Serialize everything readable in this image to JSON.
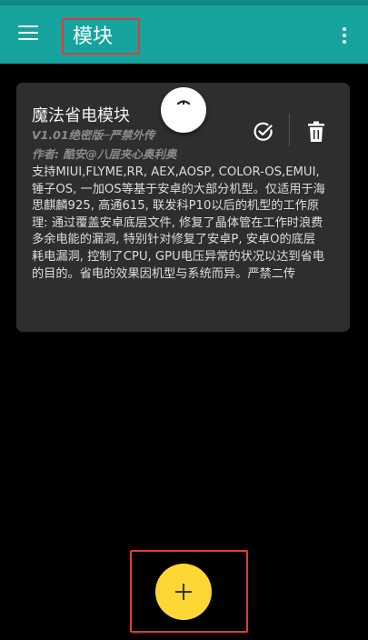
{
  "appbar": {
    "title": "模块",
    "menu_icon": "hamburger-menu-icon",
    "overflow_icon": "more-vert-icon"
  },
  "module": {
    "title": "魔法省电模块",
    "version": "V1.01绝密版─严禁外传",
    "author": "作者: 酷安@八层夹心奥利奥",
    "description": "支持MIUI,FLYME,RR, AEX,AOSP, COLOR-OS,EMUI, 锤子OS, 一加OS等基于安卓的大部分机型。仅适用于海思麒麟925, 高通615, 联发科P10以后的机型的工作原理: 通过覆盖安卓底层文件, 修复了晶体管在工作时浪费多余电能的漏洞, 特别针对修复了安卓P, 安卓O的底层耗电漏洞, 控制了CPU, GPU电压异常的状况以达到省电的目的。省电的效果因机型与系统而异。严禁二传",
    "enable_icon": "check-circle-icon",
    "delete_icon": "trash-icon"
  },
  "fab": {
    "icon": "plus-icon"
  },
  "colors": {
    "appbar": "#16a39e",
    "card": "#2e2e2e",
    "fab": "#fdd835",
    "highlight": "#e53935"
  }
}
